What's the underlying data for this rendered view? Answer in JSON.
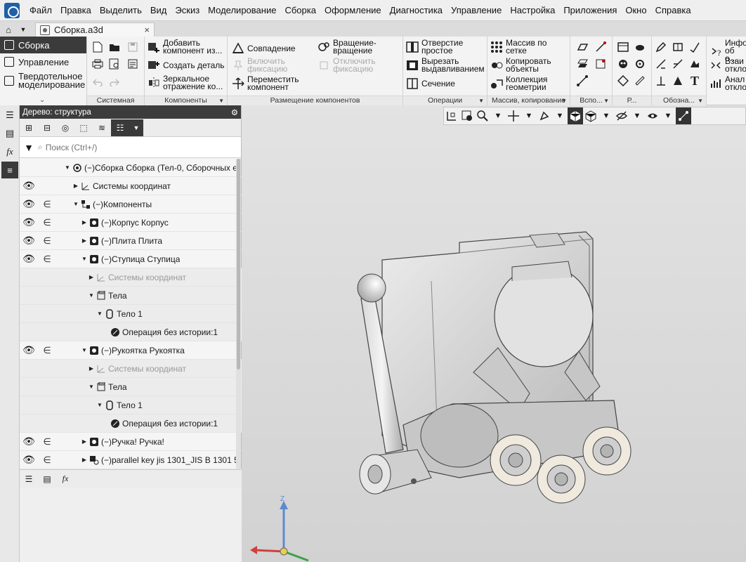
{
  "menu": [
    "Файл",
    "Правка",
    "Выделить",
    "Вид",
    "Эскиз",
    "Моделирование",
    "Сборка",
    "Оформление",
    "Диагностика",
    "Управление",
    "Настройка",
    "Приложения",
    "Окно",
    "Справка"
  ],
  "tab": {
    "title": "Сборка.a3d",
    "close": "×"
  },
  "modes": {
    "assembly": "Сборка",
    "management": "Управление",
    "solid_line1": "Твердотельное",
    "solid_line2": "моделирование",
    "expand": "⌄"
  },
  "groups": {
    "system": "Системная",
    "components": "Компоненты",
    "placement": "Размещение компонентов",
    "operations": "Операции",
    "arrays": "Массив, копирование",
    "aux": "Вспо...",
    "r": "Р...",
    "designations": "Обозна..."
  },
  "buttons": {
    "add_component_1": "Добавить",
    "add_component_2": "компонент из...",
    "create_part": "Создать деталь",
    "mirror_1": "Зеркальное",
    "mirror_2": "отражение ко...",
    "coincidence": "Совпадение",
    "rotation_1": "Вращение-",
    "rotation_2": "вращение",
    "enable_fix_1": "Включить",
    "enable_fix_2": "фиксацию",
    "disable_fix_1": "Отключить",
    "disable_fix_2": "фиксацию",
    "move_1": "Переместить",
    "move_2": "компонент",
    "hole_1": "Отверстие",
    "hole_2": "простое",
    "cut_1": "Вырезать",
    "cut_2": "выдавливанием",
    "section": "Сечение",
    "grid_array_1": "Массив по",
    "grid_array_2": "сетке",
    "copy_1": "Копировать",
    "copy_2": "объекты",
    "collection_1": "Коллекция",
    "collection_2": "геометрии",
    "info_1": "Инфо",
    "info_2": "об о...",
    "interact_1": "Взаи",
    "interact_2": "откло",
    "anal_1": "Анал",
    "anal_2": "откло"
  },
  "tree_panel": {
    "title": "Дерево: структура",
    "search_placeholder": "Поиск (Ctrl+/)"
  },
  "tree_rows": [
    {
      "label": "(−)Сборка Сборка (Тел-0, Сборочных е",
      "vis": "",
      "inc": ""
    },
    {
      "label": "Системы координат",
      "vis": "👁",
      "inc": ""
    },
    {
      "label": "(−)Компоненты",
      "vis": "👁",
      "inc": "∈"
    },
    {
      "label": "(−)Корпус Корпус",
      "vis": "👁",
      "inc": "∈"
    },
    {
      "label": "(−)Плита Плита",
      "vis": "👁",
      "inc": "∈"
    },
    {
      "label": "(−)Ступица Ступица",
      "vis": "👁",
      "inc": "∈"
    },
    {
      "label": "Системы координат",
      "vis": "",
      "inc": ""
    },
    {
      "label": "Тела",
      "vis": "",
      "inc": ""
    },
    {
      "label": "Тело 1",
      "vis": "",
      "inc": ""
    },
    {
      "label": "Операция без истории:1",
      "vis": "",
      "inc": ""
    },
    {
      "label": "(−)Рукоятка Рукоятка",
      "vis": "👁",
      "inc": "∈"
    },
    {
      "label": "Системы координат",
      "vis": "",
      "inc": ""
    },
    {
      "label": "Тела",
      "vis": "",
      "inc": ""
    },
    {
      "label": "Тело 1",
      "vis": "",
      "inc": ""
    },
    {
      "label": "Операция без истории:1",
      "vis": "",
      "inc": ""
    },
    {
      "label": "(−)Ручка! Ручка!",
      "vis": "👁",
      "inc": "∈"
    },
    {
      "label": "(−)parallel key jis 1301_JIS B 1301 5",
      "vis": "👁",
      "inc": "∈"
    }
  ],
  "triad": {
    "z": "Z",
    "x": "X"
  },
  "colors": {
    "accent": "#2f2f2f",
    "viewport_bg": "#dadada",
    "model": "#cfcfcf"
  }
}
